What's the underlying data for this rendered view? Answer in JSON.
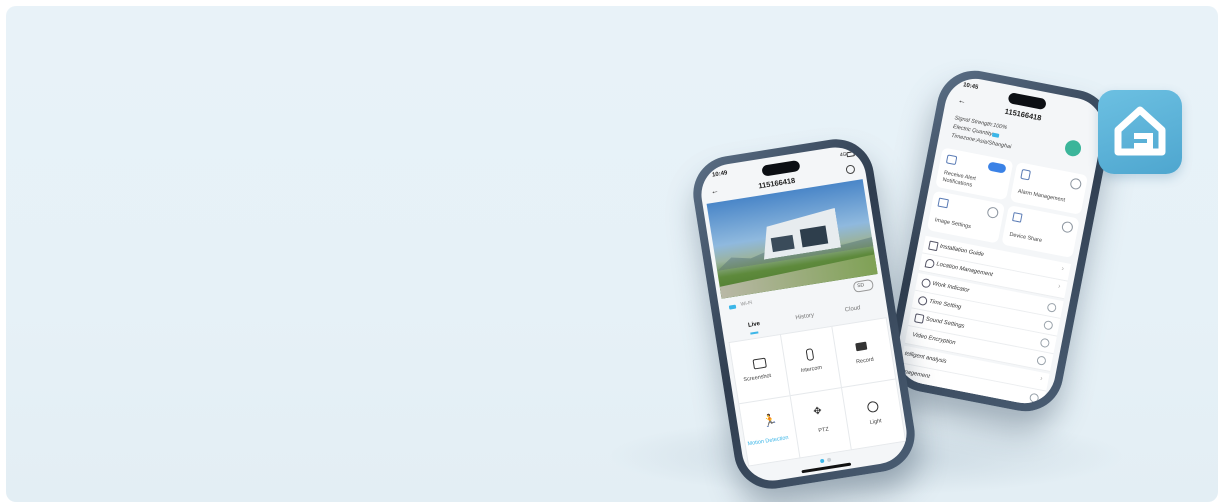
{
  "app_icon": {
    "name": "home-g-icon",
    "color": "#5fb4d9"
  },
  "left_phone": {
    "status_time": "10:49",
    "status_net": "4G",
    "device_id": "115166418",
    "wifi_signal": "Wi-Fi",
    "quality": "SD",
    "tabs": [
      {
        "label": "Live"
      },
      {
        "label": "History"
      },
      {
        "label": "Cloud"
      }
    ],
    "actions": [
      {
        "label": "Screenshot",
        "icon": "camera-icon"
      },
      {
        "label": "Intercom",
        "icon": "microphone-icon"
      },
      {
        "label": "Record",
        "icon": "video-camera-icon"
      },
      {
        "label": "Motion Detection",
        "icon": "running-person-icon"
      },
      {
        "label": "PTZ",
        "icon": "direction-pad-icon"
      },
      {
        "label": "Light",
        "icon": "light-icon"
      }
    ]
  },
  "right_phone": {
    "status_time": "10:45",
    "device_id": "115166418",
    "signal_strength": "Signal Strength:100%",
    "electric_quantity": "Electric Quantity:",
    "timezone": "Timezone:Asia/Shanghai",
    "cards": [
      {
        "label": "Receive Alert Notifications"
      },
      {
        "label": "Alarm Management"
      },
      {
        "label": "Image Settings"
      },
      {
        "label": "Device Share"
      }
    ],
    "menu": [
      {
        "label": "Installation Guide"
      },
      {
        "label": "Location Management"
      },
      {
        "label": "Work Indicator"
      },
      {
        "label": "Time Setting"
      },
      {
        "label": "Sound Settings"
      },
      {
        "label": "Video Encryption"
      },
      {
        "label": "telligent analysis"
      },
      {
        "label": "anagement"
      }
    ]
  }
}
